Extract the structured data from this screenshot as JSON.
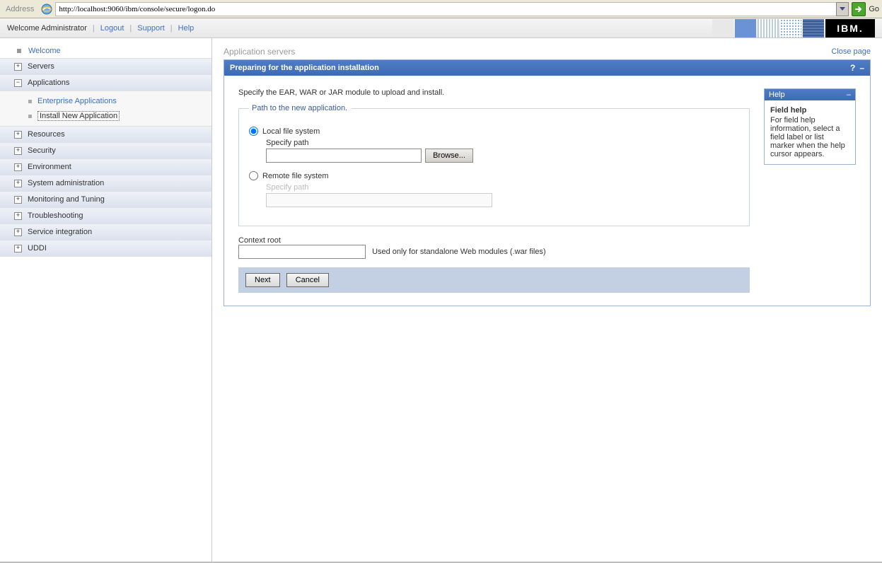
{
  "address": {
    "label": "Address",
    "url": "http://localhost:9060/ibm/console/secure/logon.do",
    "go": "Go"
  },
  "topbar": {
    "welcome": "Welcome Administrator",
    "logout": "Logout",
    "support": "Support",
    "help": "Help",
    "ibm": "IBM."
  },
  "sidebar": {
    "welcome": "Welcome",
    "items": [
      {
        "label": "Servers",
        "expanded": false
      },
      {
        "label": "Applications",
        "expanded": true,
        "children": [
          {
            "label": "Enterprise Applications",
            "selected": false
          },
          {
            "label": "Install New Application",
            "selected": true
          }
        ]
      },
      {
        "label": "Resources",
        "expanded": false
      },
      {
        "label": "Security",
        "expanded": false
      },
      {
        "label": "Environment",
        "expanded": false
      },
      {
        "label": "System administration",
        "expanded": false
      },
      {
        "label": "Monitoring and Tuning",
        "expanded": false
      },
      {
        "label": "Troubleshooting",
        "expanded": false
      },
      {
        "label": "Service integration",
        "expanded": false
      },
      {
        "label": "UDDI",
        "expanded": false
      }
    ]
  },
  "content": {
    "heading": "Application servers",
    "close": "Close page",
    "panel_title": "Preparing for the application installation",
    "instruction": "Specify the EAR, WAR or JAR module to upload and install.",
    "fieldset_legend": "Path to the new application.",
    "local_label": "Local file system",
    "specify_path": "Specify path",
    "remote_label": "Remote file system",
    "specify_path_disabled": "Specify path",
    "browse": "Browse...",
    "context_root": "Context root",
    "context_hint": "Used only for standalone Web modules (.war files)",
    "next": "Next",
    "cancel": "Cancel",
    "local_path_value": "",
    "remote_path_value": "",
    "context_root_value": ""
  },
  "help": {
    "title": "Help",
    "heading": "Field help",
    "body": "For field help information, select a field label or list marker when the help cursor appears."
  }
}
